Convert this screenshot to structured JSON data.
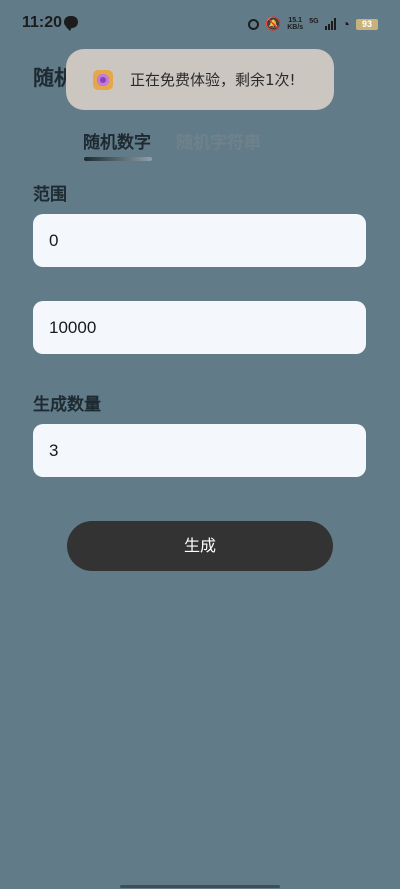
{
  "status_bar": {
    "time": "11:20",
    "net_speed_value": "15.1",
    "net_speed_unit": "KB/s",
    "network": "5G",
    "battery": "93",
    "icons": [
      "chat-bubble-icon",
      "alarm-icon",
      "mute-bell-icon",
      "signal-icon",
      "wifi-icon",
      "battery-icon"
    ]
  },
  "page": {
    "title": "随机"
  },
  "toast": {
    "text": "正在免费体验，剩余1次!"
  },
  "tabs": [
    {
      "label": "随机数字",
      "active": true
    },
    {
      "label": "随机字符串",
      "active": false
    }
  ],
  "form": {
    "range_label": "范围",
    "min_value": "0",
    "max_value": "10000",
    "count_label": "生成数量",
    "count_value": "3"
  },
  "actions": {
    "generate_label": "生成"
  },
  "colors": {
    "background": "#617b88",
    "field": "#f4f8fd",
    "button": "#333333",
    "toast": "#ccc6c1"
  }
}
